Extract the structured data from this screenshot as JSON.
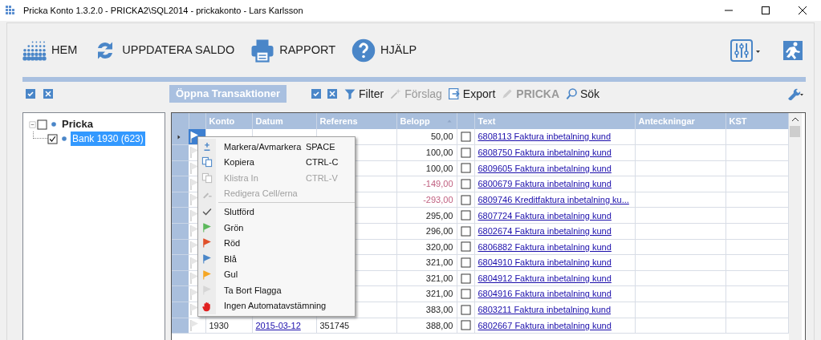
{
  "window": {
    "title": "Pricka Konto 1.3.2.0 - PRICKA2\\SQL2014 - prickakonto - Lars Karlsson"
  },
  "toolbar": [
    {
      "kind": "home",
      "label": "HEM"
    },
    {
      "kind": "refresh",
      "label": "UPPDATERA SALDO"
    },
    {
      "kind": "print",
      "label": "RAPPORT"
    },
    {
      "kind": "help",
      "label": "HJÄLP"
    }
  ],
  "grid_toolbar": {
    "title": "Öppna Transaktioner",
    "actions": [
      {
        "kind": "filter",
        "label": "Filter",
        "disabled": false,
        "bold": false
      },
      {
        "kind": "wand",
        "label": "Förslag",
        "disabled": true,
        "bold": false
      },
      {
        "kind": "export",
        "label": "Export",
        "disabled": false,
        "bold": false
      },
      {
        "kind": "pencil",
        "label": "PRICKA",
        "disabled": true,
        "bold": true
      },
      {
        "kind": "search",
        "label": "Sök",
        "disabled": false,
        "bold": false
      }
    ]
  },
  "tree": [
    {
      "label": "Pricka",
      "checked": false,
      "expanded": true,
      "selected": false,
      "children": [
        {
          "label": "Bank 1930 (623)",
          "checked": true,
          "selected": true
        }
      ]
    }
  ],
  "table": {
    "columns": [
      "Konto",
      "Datum",
      "Referens",
      "Belopp",
      "Text",
      "Anteckningar",
      "KST"
    ],
    "rows": [
      {
        "konto": "",
        "datum": "",
        "referens": "",
        "belopp": "50,00",
        "negative": false,
        "text": "6808113 Faktura inbetalning kund",
        "checked": false,
        "selected": true
      },
      {
        "konto": "",
        "datum": "",
        "referens": "",
        "belopp": "100,00",
        "negative": false,
        "text": "6808750 Faktura inbetalning kund",
        "checked": false,
        "selected": false
      },
      {
        "konto": "",
        "datum": "",
        "referens": "",
        "belopp": "100,00",
        "negative": false,
        "text": "6809605 Faktura inbetalning kund",
        "checked": false,
        "selected": false
      },
      {
        "konto": "",
        "datum": "",
        "referens": "",
        "belopp": "-149,00",
        "negative": true,
        "text": "6800679 Faktura inbetalning kund",
        "checked": false,
        "selected": false
      },
      {
        "konto": "",
        "datum": "",
        "referens": "",
        "belopp": "-293,00",
        "negative": true,
        "text": "6809746 Kreditfaktura inbetalning ku...",
        "checked": false,
        "selected": false
      },
      {
        "konto": "",
        "datum": "",
        "referens": "",
        "belopp": "295,00",
        "negative": false,
        "text": "6807724 Faktura inbetalning kund",
        "checked": false,
        "selected": false
      },
      {
        "konto": "",
        "datum": "",
        "referens": "",
        "belopp": "296,00",
        "negative": false,
        "text": "6802674 Faktura inbetalning kund",
        "checked": false,
        "selected": false
      },
      {
        "konto": "",
        "datum": "",
        "referens": "",
        "belopp": "320,00",
        "negative": false,
        "text": "6806882 Faktura inbetalning kund",
        "checked": false,
        "selected": false
      },
      {
        "konto": "",
        "datum": "",
        "referens": "",
        "belopp": "321,00",
        "negative": false,
        "text": "6804910 Faktura inbetalning kund",
        "checked": false,
        "selected": false
      },
      {
        "konto": "",
        "datum": "",
        "referens": "",
        "belopp": "321,00",
        "negative": false,
        "text": "6804912 Faktura inbetalning kund",
        "checked": false,
        "selected": false
      },
      {
        "konto": "",
        "datum": "",
        "referens": "",
        "belopp": "321,00",
        "negative": false,
        "text": "6804916 Faktura inbetalning kund",
        "checked": false,
        "selected": false
      },
      {
        "konto": "",
        "datum": "",
        "referens": "",
        "belopp": "383,00",
        "negative": false,
        "text": "6803211 Faktura inbetalning kund",
        "checked": false,
        "selected": false
      },
      {
        "konto": "1930",
        "datum": "2015-03-12",
        "referens": "351745",
        "belopp": "388,00",
        "negative": false,
        "text": "6802667 Faktura inbetalning kund",
        "checked": false,
        "selected": false
      }
    ]
  },
  "context_menu": [
    {
      "kind": "mark",
      "label": "Markera/Avmarkera",
      "shortcut": "SPACE",
      "disabled": false
    },
    {
      "kind": "copy",
      "label": "Kopiera",
      "shortcut": "CTRL-C",
      "disabled": false
    },
    {
      "kind": "paste",
      "label": "Klistra In",
      "shortcut": "CTRL-V",
      "disabled": true
    },
    {
      "kind": "edit",
      "label": "Redigera Cell/erna",
      "disabled": true,
      "separator_after": true
    },
    {
      "kind": "check",
      "label": "Slutförd",
      "disabled": false
    },
    {
      "kind": "flag",
      "label": "Grön",
      "color": "#5cb85c",
      "disabled": false
    },
    {
      "kind": "flag",
      "label": "Röd",
      "color": "#e0502a",
      "disabled": false
    },
    {
      "kind": "flag",
      "label": "Blå",
      "color": "#4a86c8",
      "disabled": false
    },
    {
      "kind": "flag",
      "label": "Gul",
      "color": "#f5a623",
      "disabled": false
    },
    {
      "kind": "flag",
      "label": "Ta Bort Flagga",
      "color": "#d6d6d6",
      "disabled": false
    },
    {
      "kind": "stop",
      "label": "Ingen Automatavstämning",
      "disabled": false
    }
  ]
}
